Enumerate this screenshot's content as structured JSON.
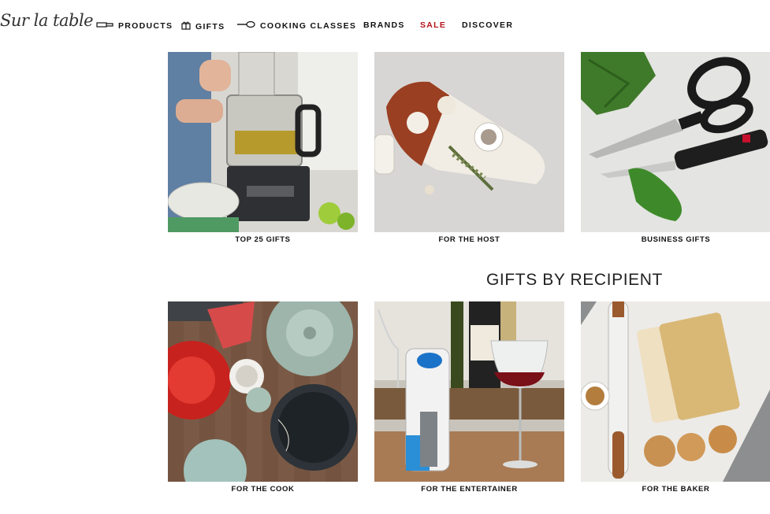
{
  "brand": {
    "logo_text": "Sur la table"
  },
  "nav": {
    "products": "PRODUCTS",
    "gifts": "GIFTS",
    "cooking_classes": "COOKING CLASSES",
    "brands": "BRANDS",
    "sale": "SALE",
    "discover": "DISCOVER",
    "sale_color": "#b5121b"
  },
  "gift_tiles": [
    {
      "label": "TOP 25 GIFTS",
      "icon": "food-processor-image"
    },
    {
      "label": "FOR THE HOST",
      "icon": "cheese-board-image"
    },
    {
      "label": "BUSINESS GIFTS",
      "icon": "kitchen-shears-image"
    }
  ],
  "recipient_section": {
    "title": "GIFTS BY RECIPIENT",
    "tiles": [
      {
        "label": "FOR THE COOK",
        "icon": "dutch-oven-image"
      },
      {
        "label": "FOR THE ENTERTAINER",
        "icon": "wine-preserver-image"
      },
      {
        "label": "FOR THE BAKER",
        "icon": "rolling-pin-image"
      }
    ]
  }
}
